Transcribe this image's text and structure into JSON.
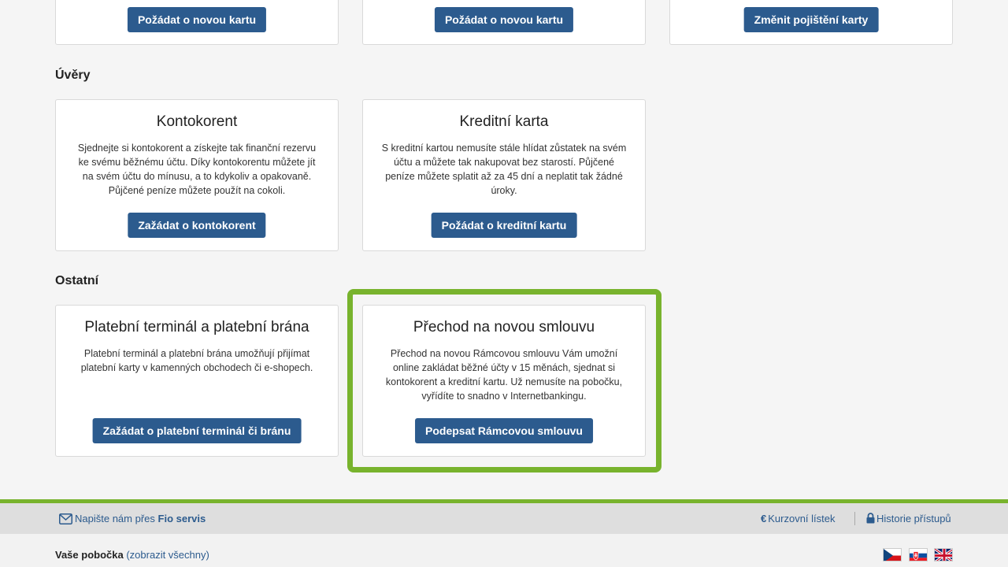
{
  "top_buttons": [
    "Požádat o novou kartu",
    "Požádat o novou kartu",
    "Změnit pojištění karty"
  ],
  "sections": {
    "uvery": {
      "title": "Úvěry",
      "cards": [
        {
          "title": "Kontokorent",
          "desc": [
            "Sjednejte si kontokorent a získejte tak finanční rezervu",
            "ke svému běžnému účtu. Díky kontokorentu můžete jít",
            "na svém účtu do mínusu, a to kdykoliv a opakovaně.",
            "Půjčené peníze můžete použít na cokoli."
          ],
          "button": "Zažádat o kontokorent"
        },
        {
          "title": "Kreditní karta",
          "desc": [
            "S kreditní kartou nemusíte stále hlídat zůstatek na svém",
            "účtu a můžete tak nakupovat bez starostí. Půjčené",
            "peníze můžete splatit až za 45 dní a neplatit tak žádné",
            "úroky."
          ],
          "button": "Požádat o kreditní kartu"
        }
      ]
    },
    "ostatni": {
      "title": "Ostatní",
      "cards": [
        {
          "title": "Platební terminál a platební brána",
          "desc": [
            "Platební terminál a platební brána umožňují přijímat",
            "platební karty v kamenných obchodech či e-shopech."
          ],
          "button": "Zažádat o platební terminál či bránu"
        },
        {
          "title": "Přechod na novou smlouvu",
          "desc": [
            "Přechod na novou Rámcovou smlouvu Vám umožní",
            "online zakládat běžné účty v 15 měnách, sjednat si",
            "kontokorent a kreditní kartu. Už nemusíte na pobočku,",
            "vyřídíte to snadno v Internetbankingu."
          ],
          "button": "Podepsat Rámcovou smlouvu"
        }
      ]
    }
  },
  "footer": {
    "write_us_prefix": "Napište nám přes",
    "write_us_link": "Fio servis",
    "exchange_rates": "Kurzovní lístek",
    "access_history": "Historie přístupů",
    "branch_label": "Vaše pobočka",
    "branch_link": "(zobrazit všechny)"
  },
  "colors": {
    "button_bg": "#2c5b8e",
    "accent_green": "#78b32d",
    "link": "#2c5b8e"
  },
  "icons": {
    "mail": "envelope-icon",
    "euro": "euro-icon",
    "lock": "lock-icon"
  }
}
